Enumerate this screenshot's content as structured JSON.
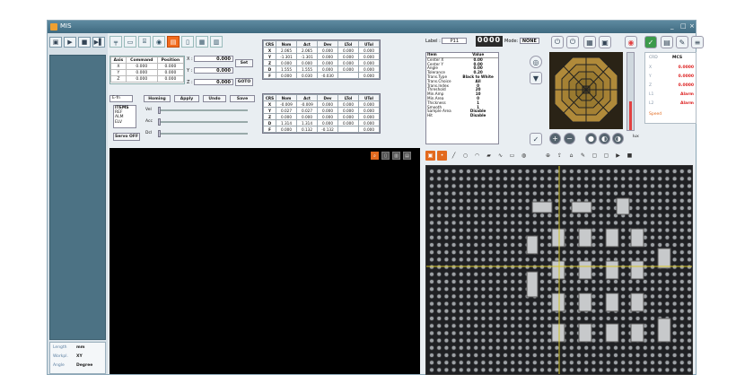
{
  "window": {
    "title": "MIS",
    "controls": [
      "_",
      "□",
      "×"
    ]
  },
  "left_panel": {
    "tool_icons": [
      "lock-icon",
      "play-icon",
      "stop-icon",
      "skip-icon"
    ],
    "info": [
      {
        "key": "Length",
        "value": "mm"
      },
      {
        "key": "Workpl.",
        "value": "XY"
      },
      {
        "key": "Angle",
        "value": "Degree"
      }
    ]
  },
  "toolbar": {
    "icons": [
      "probe-icon",
      "stage-icon",
      "fixture-icon",
      "camera-icon",
      "light-icon",
      "doc-icon",
      "export-icon",
      "print-icon"
    ],
    "active_index": 4
  },
  "dro": {
    "headers": [
      "Axis",
      "Command",
      "Position"
    ],
    "rows": [
      [
        "X",
        "0.000",
        "0.000"
      ],
      [
        "Y",
        "0.000",
        "0.000"
      ],
      [
        "Z",
        "0.000",
        "0.000"
      ]
    ]
  },
  "xyz": {
    "rows": [
      {
        "label": "X :",
        "value": "0.000"
      },
      {
        "label": "Y :",
        "value": "0.000"
      },
      {
        "label": "Z :",
        "value": "0.000"
      }
    ],
    "set_label": "Set",
    "goto_label": "GOTO"
  },
  "controls": {
    "select_value": "E-fn",
    "homing": "Homing",
    "apply": "Apply",
    "undo": "Undo",
    "save": "Save",
    "items_header": "ITEMS",
    "items": [
      "REF",
      "ALM",
      "ELV"
    ],
    "servo_off": "Servo OFF",
    "sliders": [
      {
        "label": "Vel",
        "value": "0.0"
      },
      {
        "label": "Acc",
        "value": "0.0"
      },
      {
        "label": "Dcl",
        "value": "0.0"
      }
    ]
  },
  "table_top": {
    "headers": [
      "CRS",
      "Nom",
      "Act",
      "Dev",
      "LTol",
      "UTol"
    ],
    "rows": [
      [
        "X",
        "2.065",
        "2.065",
        "0.000",
        "0.000",
        "0.000"
      ],
      [
        "Y",
        "-1.301",
        "-1.301",
        "0.000",
        "0.000",
        "0.000"
      ],
      [
        "Z",
        "0.000",
        "0.000",
        "0.000",
        "0.000",
        "0.000"
      ],
      [
        "D",
        "1.555",
        "1.555",
        "0.000",
        "0.000",
        "0.000"
      ],
      [
        "F",
        "0.000",
        "0.030",
        "-0.030",
        "",
        "0.000"
      ]
    ]
  },
  "table_bottom": {
    "headers": [
      "CRS",
      "Nom",
      "Act",
      "Dev",
      "LTol",
      "UTol"
    ],
    "rows": [
      [
        "X",
        "-0.009",
        "-0.009",
        "0.000",
        "0.000",
        "0.000"
      ],
      [
        "Y",
        "0.027",
        "0.027",
        "0.000",
        "0.000",
        "0.000"
      ],
      [
        "Z",
        "0.000",
        "0.000",
        "0.000",
        "0.000",
        "0.000"
      ],
      [
        "D",
        "1.314",
        "1.314",
        "0.000",
        "0.000",
        "0.000"
      ],
      [
        "F",
        "0.000",
        "0.132",
        "-0.132",
        "",
        "0.000"
      ]
    ]
  },
  "label_field": {
    "label": "Label :",
    "value": "P11"
  },
  "counter": "0000",
  "mode": {
    "label": "Mode:",
    "value": "NONE"
  },
  "props": {
    "headers": [
      "Item",
      "Value"
    ],
    "rows": [
      [
        "Center X",
        "0.00"
      ],
      [
        "Center Y",
        "0.00"
      ],
      [
        "Angle",
        "0.00"
      ],
      [
        "Tolerance",
        "0.20"
      ],
      [
        "Trans.Type",
        "Black to White"
      ],
      [
        "Trans.Choice",
        "All"
      ],
      [
        "Trans.Index",
        "0"
      ],
      [
        "Threshold",
        "20"
      ],
      [
        "Min.Amp",
        "10"
      ],
      [
        "Min.Area",
        "0"
      ],
      [
        "Thickness",
        "1"
      ],
      [
        "Smooth",
        "1"
      ],
      [
        "Sample Area",
        "Disable"
      ],
      [
        "Hit",
        "Disable"
      ]
    ]
  },
  "coord_panel": {
    "header_left": "CRD",
    "header_right": "MCS",
    "rows": [
      {
        "key": "X",
        "value": "0.0000"
      },
      {
        "key": "Y",
        "value": "0.0000"
      },
      {
        "key": "Z",
        "value": "0.0000"
      },
      {
        "key": "L1",
        "value": "Alarm"
      },
      {
        "key": "L2",
        "value": "Alarm"
      }
    ],
    "speed_label": "Speed"
  },
  "light": {
    "percent": 38,
    "label": "lux"
  },
  "colors": {
    "accent": "#e26a1f",
    "frame": "#4c7284",
    "alarm": "#d22222"
  }
}
